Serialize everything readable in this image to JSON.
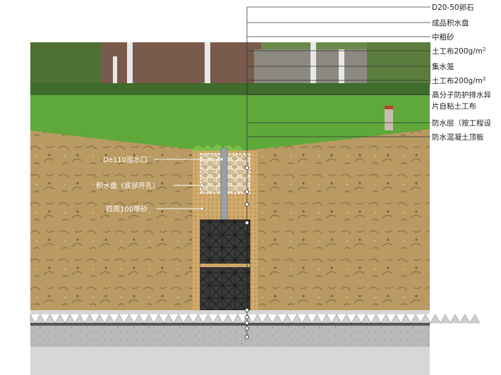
{
  "labels_right": [
    {
      "id": "pebble",
      "text": "D20-50卵石"
    },
    {
      "id": "tank",
      "text": "成品积水盘"
    },
    {
      "id": "sand",
      "text": "中粗砂"
    },
    {
      "id": "geotextile_top",
      "text": "土工布200g/m",
      "sup": "2"
    },
    {
      "id": "cage",
      "text": "集水笼"
    },
    {
      "id": "geotextile_mid",
      "text": "土工布200g/m",
      "sup": "2"
    },
    {
      "id": "drain_board",
      "text": "高分子防护排水异",
      "text2": "片自粘土工布"
    },
    {
      "id": "waterproof",
      "text": "防水层（按工程设"
    },
    {
      "id": "slab",
      "text": "防水混凝土顶板"
    }
  ],
  "labels_left": [
    {
      "id": "overflow",
      "text": "De110溢水口"
    },
    {
      "id": "tray",
      "text": "积水盘（底部开孔）"
    },
    {
      "id": "perimeter",
      "text": "四周100厚砂"
    }
  ],
  "colors": {
    "sky_building": "#7a5a4a",
    "grass": "#5fa83a",
    "soil": "#b99a63",
    "soil_dark": "#8f7448",
    "sand": "#cfa768",
    "tank": "#3a3a3a",
    "pipe": "#9aa0a6",
    "slab": "#b9b9b9",
    "leader": "#333333"
  }
}
